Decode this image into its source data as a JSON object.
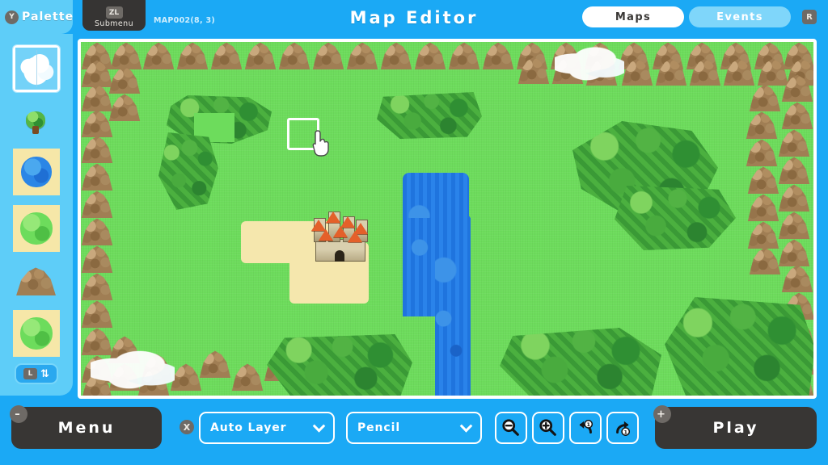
{
  "header": {
    "title": "Map Editor",
    "map_id": "MAP002(8, 3)",
    "palette_label": "Palette",
    "palette_button_badge": "Y",
    "submenu_label": "Submenu",
    "submenu_button_badge": "ZL",
    "right_button_badge": "R",
    "tabs": [
      {
        "label": "Maps",
        "active": true
      },
      {
        "label": "Events",
        "active": false
      }
    ]
  },
  "sidebar": {
    "layer_button_badge": "L",
    "layer_swap_icon": "swap-vertical-icon",
    "items": [
      {
        "name": "cloud-tile",
        "selected": true
      },
      {
        "name": "tree-tile",
        "selected": false
      },
      {
        "name": "water-tile",
        "selected": false
      },
      {
        "name": "grass-tile",
        "selected": false
      },
      {
        "name": "mountain-tile",
        "selected": false
      },
      {
        "name": "grass-tile-2",
        "selected": false
      }
    ]
  },
  "map": {
    "grass_color": "#6ddc5c",
    "water_color": "#1f74de",
    "sand_color": "#f5e7ad",
    "mountain_color": "#a07e54",
    "forest_color": "#3a9a36",
    "cloud_color": "#ffffff",
    "cursor_icon": "pointing-hand-cursor",
    "selection_box": "tile-selection-box",
    "castle_sprite": "castle-sprite"
  },
  "toolbar": {
    "menu_label": "Menu",
    "menu_badge": "–",
    "play_label": "Play",
    "play_badge": "+",
    "layer_select_badge": "X",
    "layer_select_value": "Auto Layer",
    "tool_select_value": "Pencil",
    "tools": [
      {
        "name": "zoom-out-icon",
        "label": "Zoom Out"
      },
      {
        "name": "zoom-in-icon",
        "label": "Zoom In"
      },
      {
        "name": "undo-icon",
        "label": "Undo"
      },
      {
        "name": "redo-icon",
        "label": "Redo"
      }
    ]
  },
  "colors": {
    "accent_blue": "#1ba9f5",
    "panel_blue": "#5ecdf8",
    "dark": "#383634",
    "white": "#ffffff"
  }
}
